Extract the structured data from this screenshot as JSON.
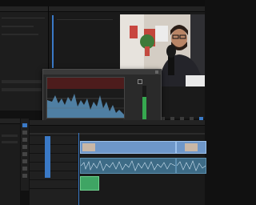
{
  "panels": {
    "source_tabs": [
      "",
      "",
      ""
    ],
    "program_tab": ""
  },
  "dialog": {
    "title": "",
    "checkbox_label": ""
  },
  "colors": {
    "clip_video": "#6e97c9",
    "clip_audio": "#3d6b86",
    "clip_green": "#3fa564",
    "playhead": "#3a79c6"
  },
  "icons": [
    "selection-tool-icon",
    "track-select-icon",
    "ripple-edit-icon",
    "razor-icon",
    "slip-icon",
    "pen-icon",
    "hand-icon",
    "type-icon"
  ]
}
